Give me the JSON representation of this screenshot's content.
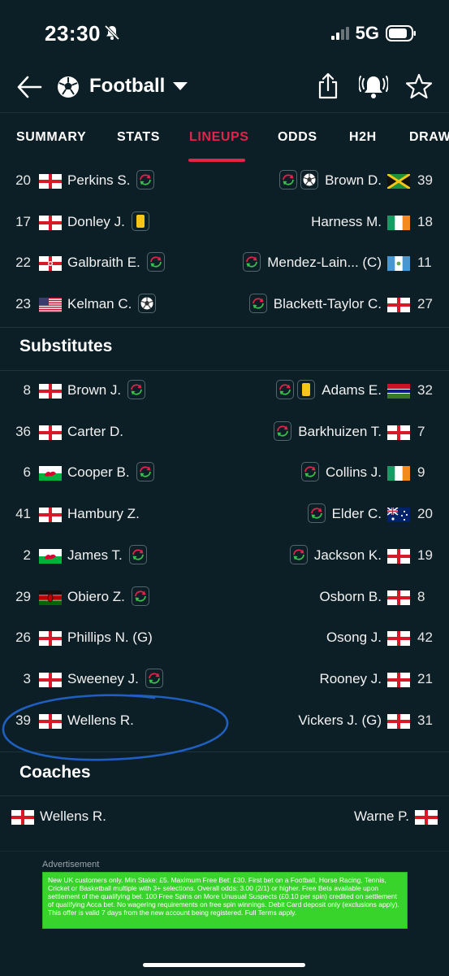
{
  "status": {
    "time": "23:30",
    "network": "5G"
  },
  "header": {
    "title": "Football"
  },
  "tabs": [
    {
      "label": "SUMMARY",
      "active": false
    },
    {
      "label": "STATS",
      "active": false
    },
    {
      "label": "LINEUPS",
      "active": true
    },
    {
      "label": "ODDS",
      "active": false
    },
    {
      "label": "H2H",
      "active": false
    },
    {
      "label": "DRAW",
      "active": false
    }
  ],
  "starters": [
    {
      "home": {
        "num": "20",
        "name": "Perkins S.",
        "flag": "england",
        "badges": [
          "sub"
        ]
      },
      "away": {
        "num": "39",
        "name": "Brown D.",
        "flag": "jamaica",
        "badges": [
          "sub",
          "ball"
        ]
      }
    },
    {
      "home": {
        "num": "17",
        "name": "Donley J.",
        "flag": "england",
        "badges": [
          "yellow"
        ]
      },
      "away": {
        "num": "18",
        "name": "Harness M.",
        "flag": "ireland",
        "badges": []
      }
    },
    {
      "home": {
        "num": "22",
        "name": "Galbraith E.",
        "flag": "northern-ireland",
        "badges": [
          "sub"
        ]
      },
      "away": {
        "num": "11",
        "name": "Mendez-Lain... (C)",
        "flag": "guatemala",
        "badges": [
          "sub"
        ]
      }
    },
    {
      "home": {
        "num": "23",
        "name": "Kelman C.",
        "flag": "usa",
        "badges": [
          "ball"
        ]
      },
      "away": {
        "num": "27",
        "name": "Blackett-Taylor C.",
        "flag": "england",
        "badges": [
          "sub"
        ]
      }
    }
  ],
  "substitutes_title": "Substitutes",
  "substitutes": [
    {
      "home": {
        "num": "8",
        "name": "Brown J.",
        "flag": "england",
        "badges": [
          "sub"
        ]
      },
      "away": {
        "num": "32",
        "name": "Adams E.",
        "flag": "gambia",
        "badges": [
          "sub",
          "yellow"
        ]
      }
    },
    {
      "home": {
        "num": "36",
        "name": "Carter D.",
        "flag": "england",
        "badges": []
      },
      "away": {
        "num": "7",
        "name": "Barkhuizen T.",
        "flag": "england",
        "badges": [
          "sub"
        ]
      }
    },
    {
      "home": {
        "num": "6",
        "name": "Cooper B.",
        "flag": "wales",
        "badges": [
          "sub"
        ]
      },
      "away": {
        "num": "9",
        "name": "Collins J.",
        "flag": "ireland",
        "badges": [
          "sub"
        ]
      }
    },
    {
      "home": {
        "num": "41",
        "name": "Hambury Z.",
        "flag": "england",
        "badges": []
      },
      "away": {
        "num": "20",
        "name": "Elder C.",
        "flag": "australia",
        "badges": [
          "sub"
        ]
      }
    },
    {
      "home": {
        "num": "2",
        "name": "James T.",
        "flag": "wales",
        "badges": [
          "sub"
        ]
      },
      "away": {
        "num": "19",
        "name": "Jackson K.",
        "flag": "england",
        "badges": [
          "sub"
        ]
      }
    },
    {
      "home": {
        "num": "29",
        "name": "Obiero Z.",
        "flag": "kenya",
        "badges": [
          "sub"
        ]
      },
      "away": {
        "num": "8",
        "name": "Osborn B.",
        "flag": "england",
        "badges": []
      }
    },
    {
      "home": {
        "num": "26",
        "name": "Phillips N. (G)",
        "flag": "england",
        "badges": []
      },
      "away": {
        "num": "42",
        "name": "Osong J.",
        "flag": "england",
        "badges": []
      }
    },
    {
      "home": {
        "num": "3",
        "name": "Sweeney J.",
        "flag": "england",
        "badges": [
          "sub"
        ]
      },
      "away": {
        "num": "21",
        "name": "Rooney J.",
        "flag": "england",
        "badges": []
      }
    },
    {
      "home": {
        "num": "39",
        "name": "Wellens R.",
        "flag": "england",
        "badges": []
      },
      "away": {
        "num": "31",
        "name": "Vickers J. (G)",
        "flag": "england",
        "badges": []
      }
    }
  ],
  "coaches_title": "Coaches",
  "coaches": {
    "home": {
      "name": "Wellens R.",
      "flag": "england"
    },
    "away": {
      "name": "Warne P.",
      "flag": "england"
    }
  },
  "ad": {
    "label": "Advertisement",
    "text": "New UK customers only. Min Stake: £5. Maximum Free Bet: £30. First bet on a Football, Horse Racing, Tennis, Cricket or Basketball multiple with 3+ selections. Overall odds: 3.00 (2/1) or higher. Free Bets available upon settlement of the qualifying bet. 100 Free Spins on More Unusual Suspects (£0.10 per spin) credited on settlement of qualifying Acca bet. No wagering requirements on free spin winnings. Debit Card deposit only (exclusions apply). This offer is valid 7 days from the new account being registered. Full Terms apply."
  },
  "colors": {
    "background": "#0d1f26",
    "accent": "#e3234a",
    "ad_green": "#39d42b",
    "annotation_blue": "#1f5fc0"
  }
}
